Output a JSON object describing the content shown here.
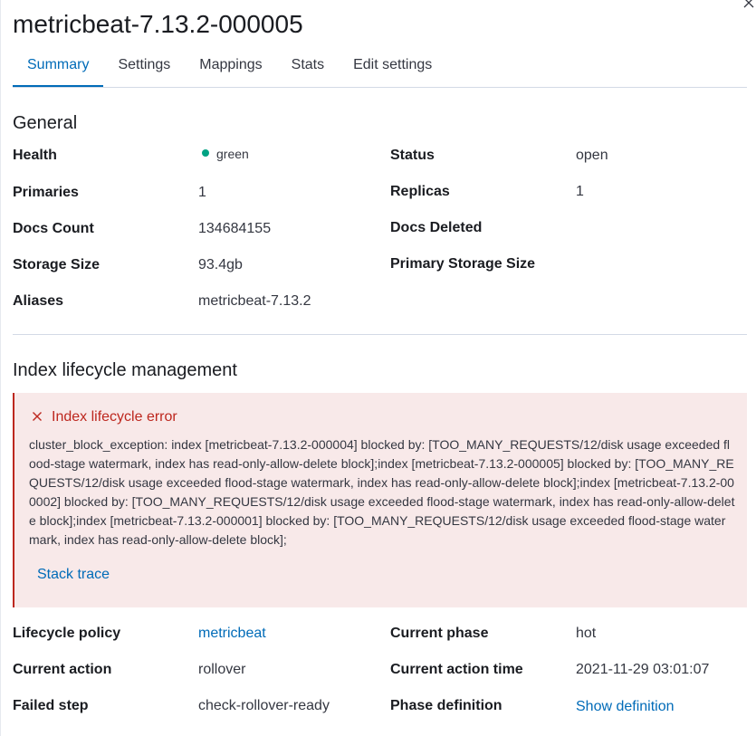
{
  "flyout": {
    "title": "metricbeat-7.13.2-000005",
    "close_label": "×"
  },
  "tabs": [
    {
      "label": "Summary",
      "active": true
    },
    {
      "label": "Settings",
      "active": false
    },
    {
      "label": "Mappings",
      "active": false
    },
    {
      "label": "Stats",
      "active": false
    },
    {
      "label": "Edit settings",
      "active": false
    }
  ],
  "general": {
    "title": "General",
    "health_label": "Health",
    "health_value": "green",
    "health_color": "#00a383",
    "status_label": "Status",
    "status_value": "open",
    "primaries_label": "Primaries",
    "primaries_value": "1",
    "replicas_label": "Replicas",
    "replicas_value": "1",
    "docs_count_label": "Docs Count",
    "docs_count_value": "134684155",
    "docs_deleted_label": "Docs Deleted",
    "docs_deleted_value": "",
    "storage_size_label": "Storage Size",
    "storage_size_value": "93.4gb",
    "primary_storage_label": "Primary Storage Size",
    "primary_storage_value": "",
    "aliases_label": "Aliases",
    "aliases_value": "metricbeat-7.13.2"
  },
  "ilm": {
    "title": "Index lifecycle management",
    "error_title": "Index lifecycle error",
    "error_message": "cluster_block_exception: index [metricbeat-7.13.2-000004] blocked by: [TOO_MANY_REQUESTS/12/disk usage exceeded flood-stage watermark, index has read-only-allow-delete block];index [metricbeat-7.13.2-000005] blocked by: [TOO_MANY_REQUESTS/12/disk usage exceeded flood-stage watermark, index has read-only-allow-delete block];index [metricbeat-7.13.2-000002] blocked by: [TOO_MANY_REQUESTS/12/disk usage exceeded flood-stage watermark, index has read-only-allow-delete block];index [metricbeat-7.13.2-000001] blocked by: [TOO_MANY_REQUESTS/12/disk usage exceeded flood-stage watermark, index has read-only-allow-delete block];",
    "stack_trace_label": "Stack trace",
    "policy_label": "Lifecycle policy",
    "policy_value": "metricbeat",
    "phase_label": "Current phase",
    "phase_value": "hot",
    "action_label": "Current action",
    "action_value": "rollover",
    "action_time_label": "Current action time",
    "action_time_value": "2021-11-29 03:01:07",
    "failed_step_label": "Failed step",
    "failed_step_value": "check-rollover-ready",
    "phase_def_label": "Phase definition",
    "phase_def_value": "Show definition"
  },
  "colors": {
    "accent": "#006bb8",
    "danger": "#bd271e",
    "danger_bg": "#f8e9e9",
    "success": "#00a383"
  }
}
